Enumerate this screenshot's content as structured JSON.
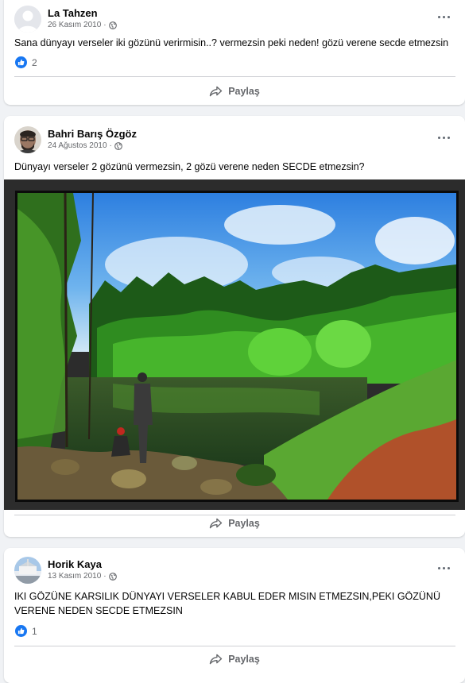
{
  "posts": [
    {
      "author": "La Tahzen",
      "date": "26 Kasım 2010",
      "text": "Sana dünyayı verseler iki gözünü verirmisin..? vermezsin peki neden! gözü verene secde etmezsin",
      "reaction_count": "2",
      "share_label": "Paylaş"
    },
    {
      "author": "Bahri Barış Özgöz",
      "date": "24 Ağustos 2010",
      "text": "Dünyayı verseler 2 gözünü vermezsin, 2 gözü verene neden SECDE etmezsin?",
      "share_label": "Paylaş"
    },
    {
      "author": "Horik Kaya",
      "date": "13 Kasım 2010",
      "text": "IKI GÖZÜNE KARSILIK DÜNYAYI VERSELER KABUL EDER MISIN ETMEZSIN,PEKI GÖZÜNÜ VERENE NEDEN SECDE ETMEZSIN",
      "reaction_count": "1",
      "share_label": "Paylaş"
    }
  ],
  "colors": {
    "background": "#f0f2f5",
    "card": "#ffffff",
    "like_blue": "#1877f2",
    "secondary_text": "#65676b"
  },
  "icons": [
    "more-options-icon",
    "globe-icon",
    "like-icon",
    "share-icon"
  ]
}
